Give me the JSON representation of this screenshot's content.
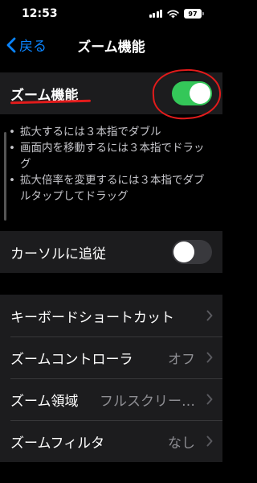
{
  "status": {
    "time": "12:53",
    "battery": "97"
  },
  "nav": {
    "back_label": "戻る",
    "title": "ズーム機能"
  },
  "zoom_toggle": {
    "label": "ズーム機能",
    "on": true
  },
  "help": [
    "拡大するには３本指でダブル",
    "画面内を移動するには３本指でドラッグ",
    "拡大倍率を変更するには３本指でダブルタップしてドラッグ"
  ],
  "follow_cursor": {
    "label": "カーソルに追従",
    "on": false
  },
  "settings": [
    {
      "label": "キーボードショートカット",
      "value": ""
    },
    {
      "label": "ズームコントローラ",
      "value": "オフ"
    },
    {
      "label": "ズーム領域",
      "value": "フルスクリー…"
    },
    {
      "label": "ズームフィルタ",
      "value": "なし"
    }
  ],
  "colors": {
    "accent": "#0a84ff",
    "toggle_on": "#34c759",
    "annotation": "#e11b1b"
  }
}
